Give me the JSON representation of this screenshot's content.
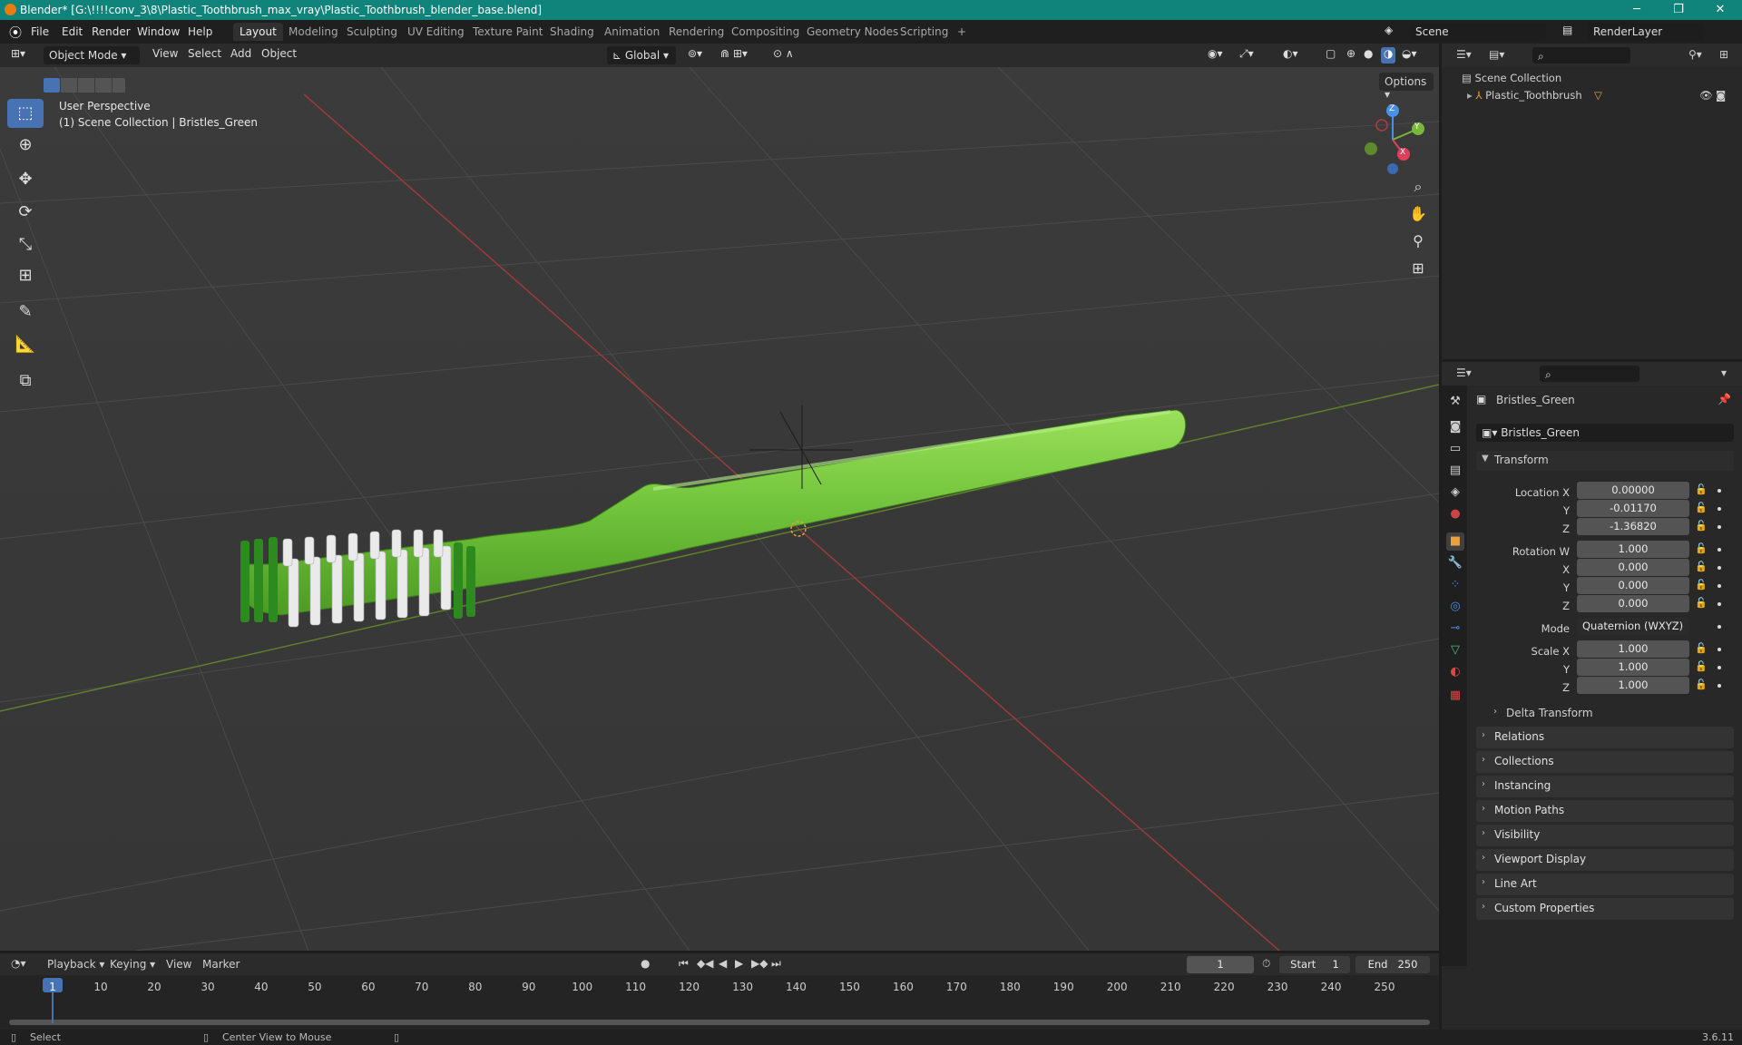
{
  "titlebar": {
    "title": "Blender* [G:\\!!!!conv_3\\8\\Plastic_Toothbrush_max_vray\\Plastic_Toothbrush_blender_base.blend]",
    "minimize": "─",
    "restore": "❐",
    "close": "✕"
  },
  "menu": {
    "file": "File",
    "edit": "Edit",
    "render": "Render",
    "window": "Window",
    "help": "Help"
  },
  "workspaces": [
    "Layout",
    "Modeling",
    "Sculpting",
    "UV Editing",
    "Texture Paint",
    "Shading",
    "Animation",
    "Rendering",
    "Compositing",
    "Geometry Nodes",
    "Scripting"
  ],
  "scene": {
    "scene_name": "Scene",
    "render_layer": "RenderLayer"
  },
  "viewport_header": {
    "mode": "Object Mode",
    "view": "View",
    "select": "Select",
    "add": "Add",
    "object": "Object",
    "orientation": "Global",
    "options": "Options"
  },
  "viewport": {
    "perspective": "User Perspective",
    "collection_info": "(1) Scene Collection | Bristles_Green"
  },
  "gizmo": {
    "x": "X",
    "y": "Y",
    "z": "Z"
  },
  "outliner": {
    "root": "Scene Collection",
    "item": "Plastic_Toothbrush"
  },
  "properties": {
    "object_name": "Bristles_Green",
    "data_name": "Bristles_Green",
    "transform_title": "Transform",
    "location_label": "Location X",
    "location": {
      "x": "0.00000",
      "y": "-0.01170",
      "z": "-1.36820"
    },
    "rotation_label": "Rotation W",
    "rotation": {
      "w": "1.000",
      "x": "0.000",
      "y": "0.000",
      "z": "0.000"
    },
    "mode_label": "Mode",
    "mode_value": "Quaternion (WXYZ)",
    "scale_label": "Scale X",
    "scale": {
      "x": "1.000",
      "y": "1.000",
      "z": "1.000"
    },
    "axis_y": "Y",
    "axis_z": "Z",
    "axis_x": "X",
    "delta": "Delta Transform",
    "panels": [
      "Relations",
      "Collections",
      "Instancing",
      "Motion Paths",
      "Visibility",
      "Viewport Display",
      "Line Art",
      "Custom Properties"
    ]
  },
  "timeline": {
    "playback": "Playback",
    "keying": "Keying",
    "view": "View",
    "marker": "Marker",
    "current_frame": "1",
    "start_label": "Start",
    "start": "1",
    "end_label": "End",
    "end": "250",
    "ticks": [
      "1",
      "10",
      "20",
      "30",
      "40",
      "50",
      "60",
      "70",
      "80",
      "90",
      "100",
      "110",
      "120",
      "130",
      "140",
      "150",
      "160",
      "170",
      "180",
      "190",
      "200",
      "210",
      "220",
      "230",
      "240",
      "250"
    ]
  },
  "statusbar": {
    "select": "Select",
    "center_view": "Center View to Mouse",
    "version": "3.6.11"
  }
}
